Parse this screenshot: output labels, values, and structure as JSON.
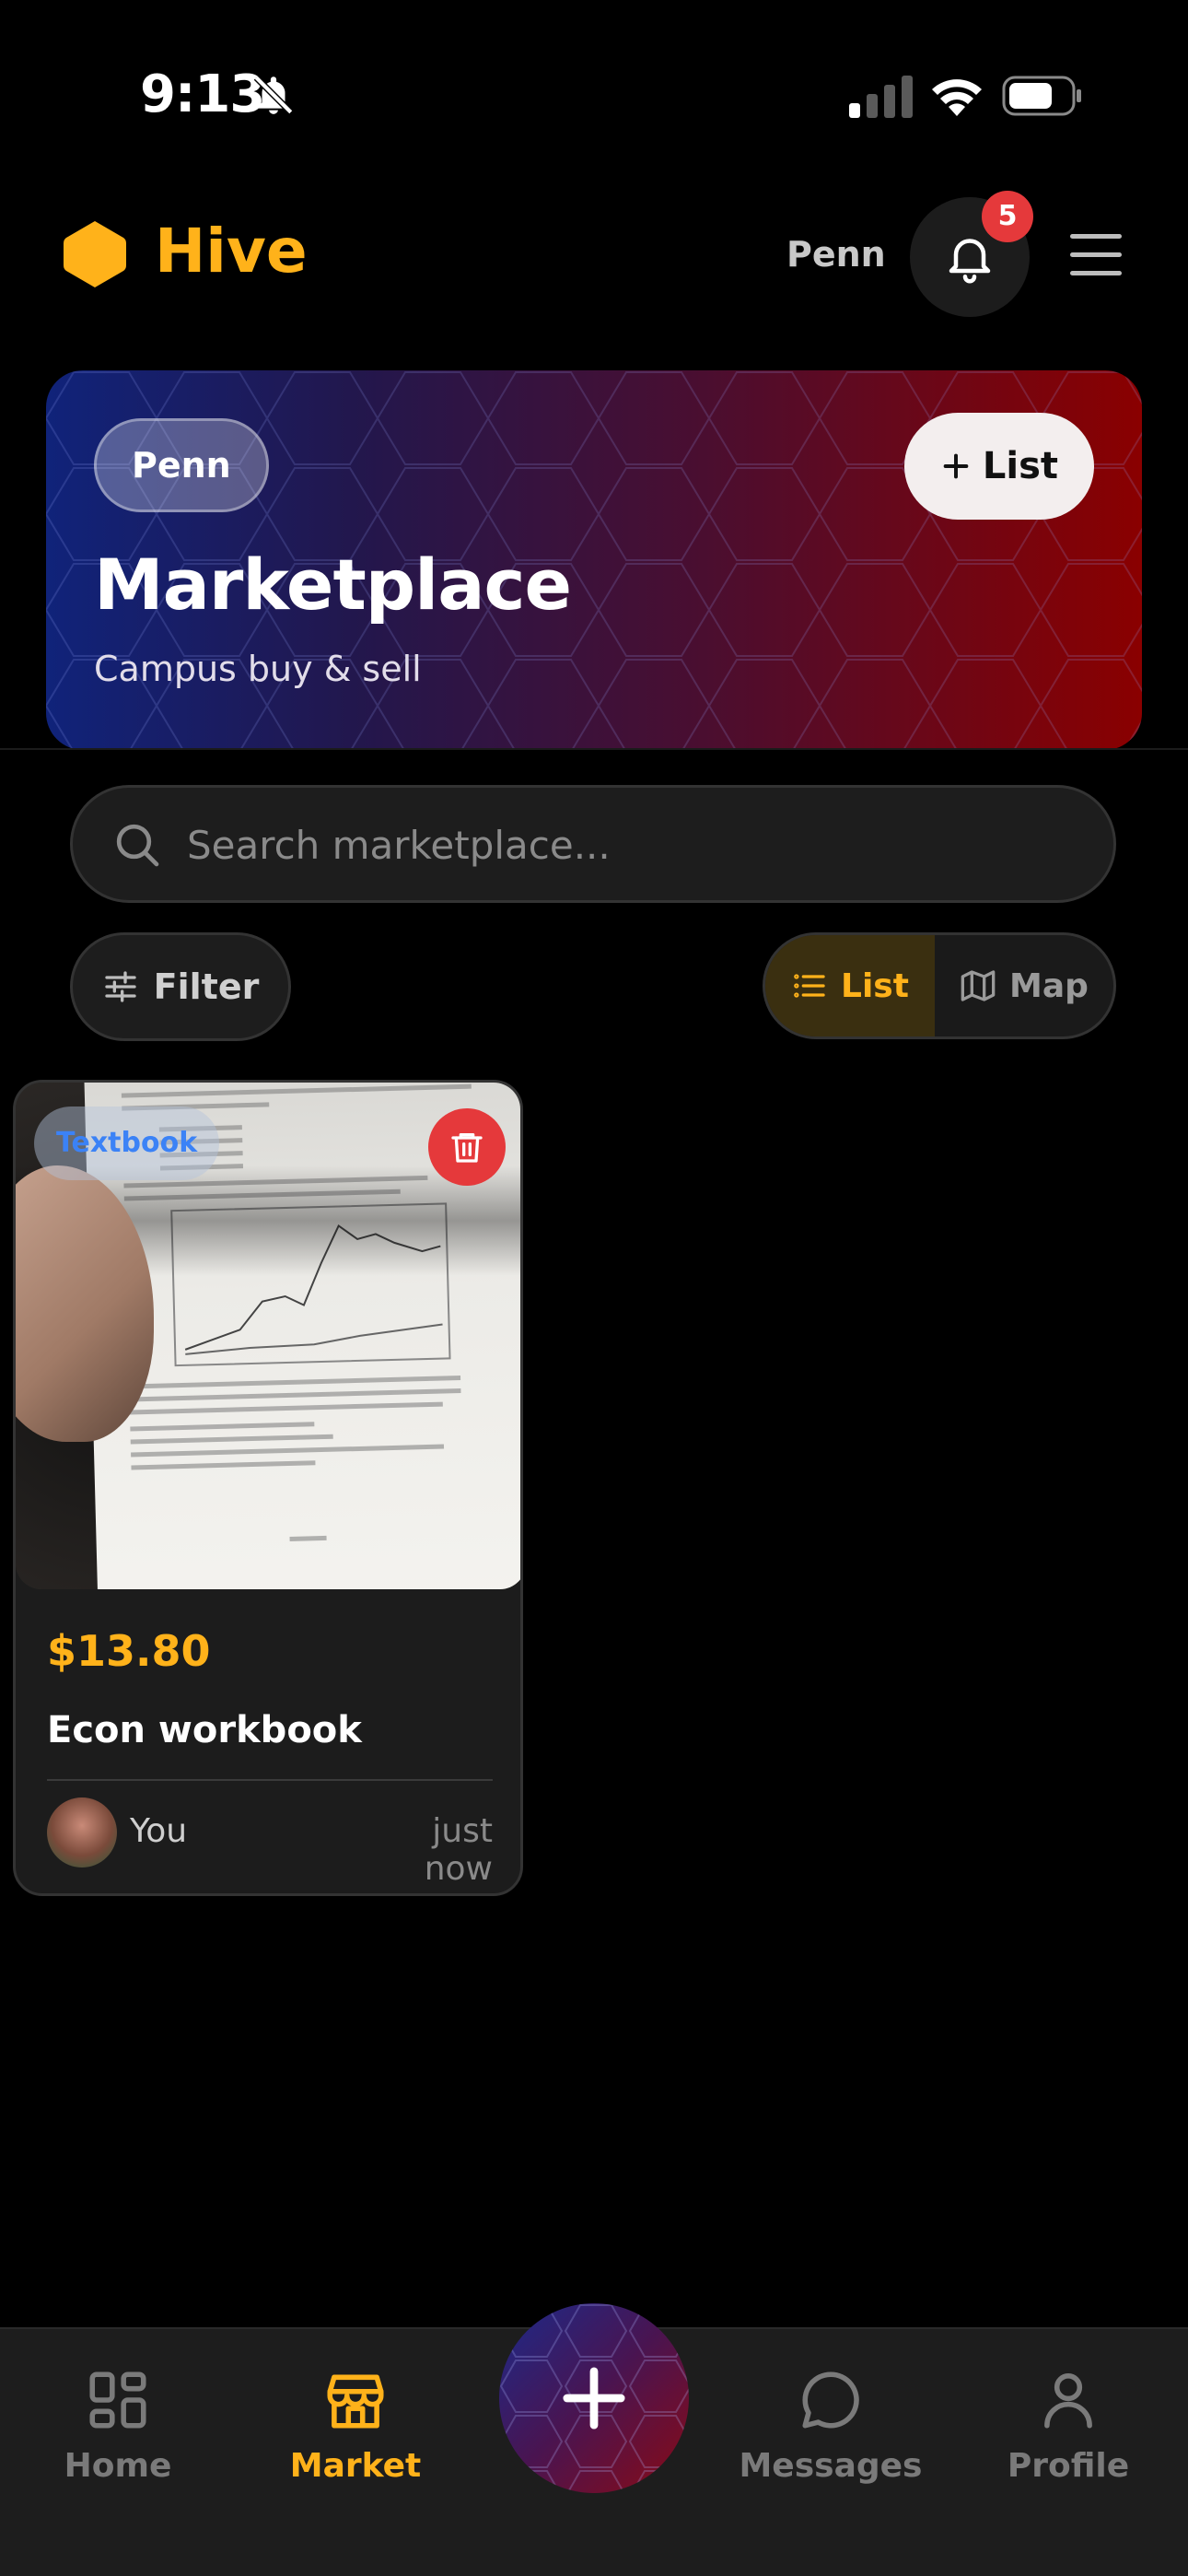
{
  "status_bar": {
    "time": "9:13"
  },
  "header": {
    "app_name": "Hive",
    "campus": "Penn",
    "notification_count": "5"
  },
  "hero": {
    "campus_chip": "Penn",
    "list_button": "List",
    "title": "Marketplace",
    "subtitle": "Campus buy & sell"
  },
  "search": {
    "placeholder": "Search marketplace..."
  },
  "filters": {
    "filter_label": "Filter",
    "view_list": "List",
    "view_map": "Map",
    "active_view": "List"
  },
  "listings": [
    {
      "category": "Textbook",
      "price": "$13.80",
      "title": "Econ workbook",
      "seller": "You",
      "posted": "just now"
    }
  ],
  "bottom_nav": {
    "items": [
      {
        "label": "Home",
        "icon": "grid-icon"
      },
      {
        "label": "Market",
        "icon": "store-icon",
        "active": true
      },
      {
        "label": "Messages",
        "icon": "chat-bubble-icon"
      },
      {
        "label": "Profile",
        "icon": "person-icon"
      }
    ]
  },
  "colors": {
    "accent": "#FFB21A",
    "danger": "#E5393B",
    "background": "#000000",
    "surface": "#1C1C1C"
  }
}
